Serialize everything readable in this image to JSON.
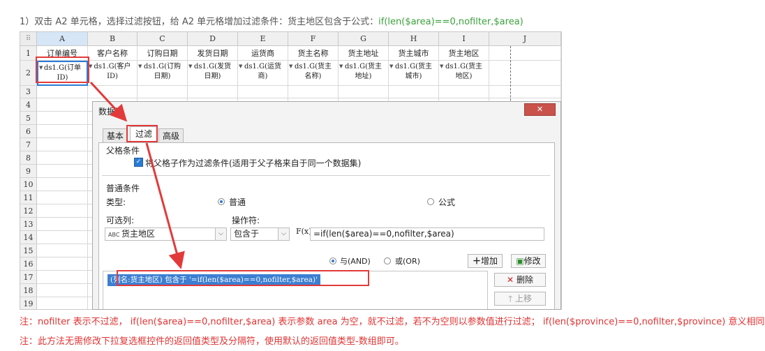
{
  "instruction": {
    "prefix": "1）双击 A2 单元格，选择过滤按钮，给 A2 单元格增加过滤条件：货主地区包含于公式：",
    "formula": "if(len($area)==0,nofilter,$area)"
  },
  "sheet": {
    "columns": [
      "A",
      "B",
      "C",
      "D",
      "E",
      "F",
      "G",
      "H",
      "I",
      "J"
    ],
    "rows": [
      "1",
      "2",
      "3",
      "4",
      "5",
      "6",
      "7",
      "8",
      "9",
      "10",
      "11",
      "12",
      "13",
      "14",
      "15",
      "16",
      "17",
      "18",
      "19"
    ],
    "row1": [
      "订单编号",
      "客户名称",
      "订购日期",
      "发货日期",
      "运货商",
      "货主名称",
      "货主地址",
      "货主城市",
      "货主地区"
    ],
    "row2": [
      [
        "ds1.G(订单",
        "ID)"
      ],
      [
        "ds1.G(客户",
        "ID)"
      ],
      [
        "ds1.G(订购",
        "日期)"
      ],
      [
        "ds1.G(发货",
        "日期)"
      ],
      [
        "ds1.G(运货",
        "商)"
      ],
      [
        "ds1.G(货主",
        "名称)"
      ],
      [
        "ds1.G(货主",
        "地址)"
      ],
      [
        "ds1.G(货主",
        "城市)"
      ],
      [
        "ds1.G(货主",
        "地区)"
      ]
    ]
  },
  "dialog": {
    "title": "数据列",
    "close_label": "✕",
    "tabs": [
      "基本",
      "过滤",
      "高级"
    ],
    "parent_section": "父格条件",
    "parent_checkbox_label": "将父格子作为过滤条件(适用于父子格来自于同一个数据集)",
    "normal_section": "普通条件",
    "type_label": "类型:",
    "type_normal": "普通",
    "type_formula": "公式",
    "selectable_col_label": "可选列:",
    "operator_label": "操作符:",
    "column_value": "货主地区",
    "operator_value": "包含于",
    "fx_label": "F(x)",
    "formula_value": "=if(len($area)==0,nofilter,$area)",
    "and_label": "与(AND)",
    "or_label": "或(OR)",
    "add_label": "增加",
    "modify_label": "修改",
    "delete_label": "删除",
    "up_label": "上移",
    "condition_item": "(列名:货主地区) 包含于 '=if(len($area)==0,nofilter,$area)'"
  },
  "notes": {
    "line1": "注：nofilter 表示不过滤， if(len($area)==0,nofilter,$area)  表示参数 area 为空，就不过滤，若不为空则以参数值进行过滤； if(len($province)==0,nofilter,$province) 意义相同。",
    "line2": "注：此方法无需修改下拉复选框控件的返回值类型及分隔符，使用默认的返回值类型-数组即可。"
  },
  "colors": {
    "accent": "#2b7bd6",
    "annotation_red": "#e23a3a",
    "formula_green": "#3aa13a",
    "note_red": "#e03333"
  }
}
